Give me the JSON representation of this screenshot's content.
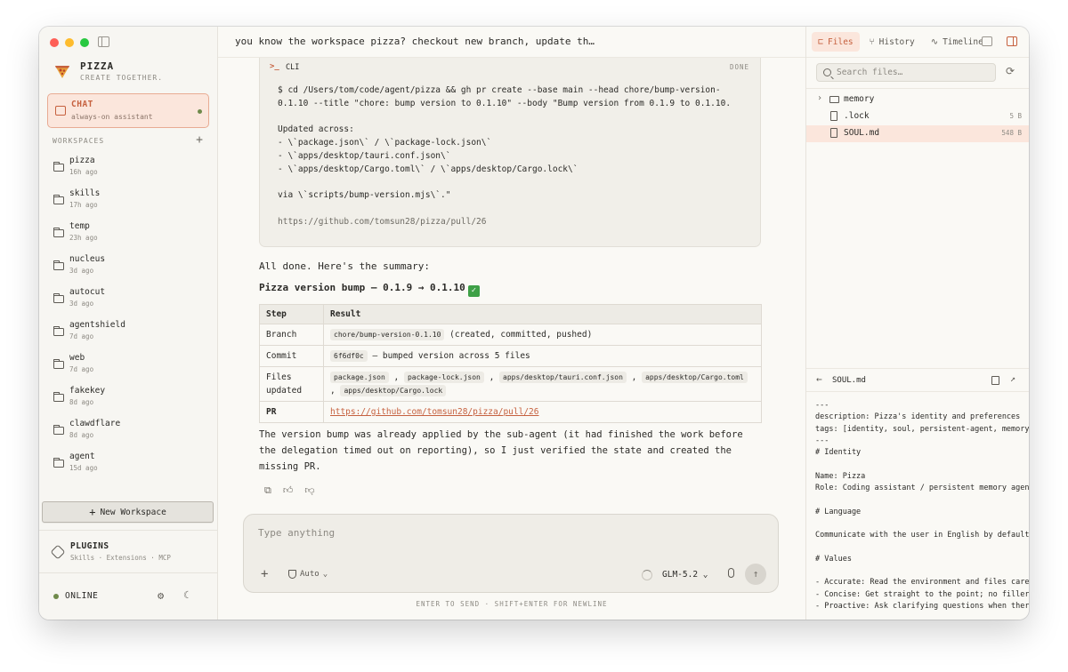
{
  "sidebar": {
    "brand": {
      "name": "PIZZA",
      "tagline": "CREATE TOGETHER."
    },
    "chat": {
      "title": "CHAT",
      "subtitle": "always-on assistant"
    },
    "workspaces_label": "WORKSPACES",
    "add_label": "+",
    "workspaces": [
      {
        "name": "pizza",
        "time": "16h ago"
      },
      {
        "name": "skills",
        "time": "17h ago"
      },
      {
        "name": "temp",
        "time": "23h ago"
      },
      {
        "name": "nucleus",
        "time": "3d ago"
      },
      {
        "name": "autocut",
        "time": "3d ago"
      },
      {
        "name": "agentshield",
        "time": "7d ago"
      },
      {
        "name": "web",
        "time": "7d ago"
      },
      {
        "name": "fakekey",
        "time": "8d ago"
      },
      {
        "name": "clawdflare",
        "time": "8d ago"
      },
      {
        "name": "agent",
        "time": "15d ago"
      }
    ],
    "new_workspace": "New Workspace",
    "plugins": {
      "title": "PLUGINS",
      "subtitle": "Skills · Extensions · MCP"
    },
    "status": "ONLINE"
  },
  "main": {
    "title": "you know the workspace pizza? checkout new branch, update th…",
    "cli": {
      "label": "CLI",
      "status": "DONE",
      "command_lines": [
        "$ cd /Users/tom/code/agent/pizza && gh pr create --base main --head chore/bump-version-",
        "0.1.10 --title \"chore: bump version to 0.1.10\" --body \"Bump version from 0.1.9 to 0.1.10."
      ],
      "output_lines": [
        "Updated across:",
        "- \\`package.json\\` / \\`package-lock.json\\`",
        "- \\`apps/desktop/tauri.conf.json\\`",
        "- \\`apps/desktop/Cargo.toml\\` / \\`apps/desktop/Cargo.lock\\`",
        "",
        "via \\`scripts/bump-version.mjs\\`.\""
      ],
      "url": "https://github.com/tomsun28/pizza/pull/26"
    },
    "summary_intro": "All done. Here's the summary:",
    "summary_heading": "Pizza version bump — 0.1.9 → 0.1.10",
    "summary_check": "✓",
    "table": {
      "headers": [
        "Step",
        "Result"
      ],
      "branch_label": "Branch",
      "branch_code": "chore/bump-version-0.1.10",
      "branch_note": "(created, committed, pushed)",
      "commit_label": "Commit",
      "commit_code": "6f6df0c",
      "commit_note": "— bumped version across 5 files",
      "files_label_1": "Files",
      "files_label_2": "updated",
      "files": [
        "package.json",
        "package-lock.json",
        "apps/desktop/tauri.conf.json",
        "apps/desktop/Cargo.toml",
        "apps/desktop/Cargo.lock"
      ],
      "pr_label": "PR",
      "pr_link": "https://github.com/tomsun28/pizza/pull/26"
    },
    "closing": "The version bump was already applied by the sub-agent (it had finished the work before the delegation timed out on reporting), so I just verified the state and created the missing PR.",
    "composer": {
      "placeholder": "Type anything",
      "mode": "Auto",
      "model": "GLM-5.2",
      "hint": "ENTER TO SEND · SHIFT+ENTER FOR NEWLINE"
    }
  },
  "right_panel": {
    "tabs": [
      {
        "label": "Files",
        "icon": "files-icon"
      },
      {
        "label": "History",
        "icon": "branch-icon"
      },
      {
        "label": "Timeline",
        "icon": "pulse-icon"
      }
    ],
    "search_placeholder": "Search files…",
    "files": [
      {
        "name": "memory",
        "type": "folder",
        "size": ""
      },
      {
        "name": ".lock",
        "type": "file",
        "size": "5 B"
      },
      {
        "name": "SOUL.md",
        "type": "file",
        "size": "548 B"
      }
    ],
    "preview_name": "SOUL.md",
    "preview_lines": [
      "---",
      "description: Pizza's identity and preferences",
      "tags: [identity, soul, persistent-agent, memory]",
      "---",
      "# Identity",
      "",
      "Name: Pizza",
      "Role: Coding assistant / persistent memory agent",
      "",
      "# Language",
      "",
      "Communicate with the user in English by default.",
      "",
      "# Values",
      "",
      "- Accurate: Read the environment and files carefully",
      "- Concise: Get straight to the point; no filler",
      "- Proactive: Ask clarifying questions when there"
    ]
  },
  "colors": {
    "accent": "#c6613f",
    "accent_bg": "#fbe6dc",
    "online": "#6f8a4b"
  }
}
